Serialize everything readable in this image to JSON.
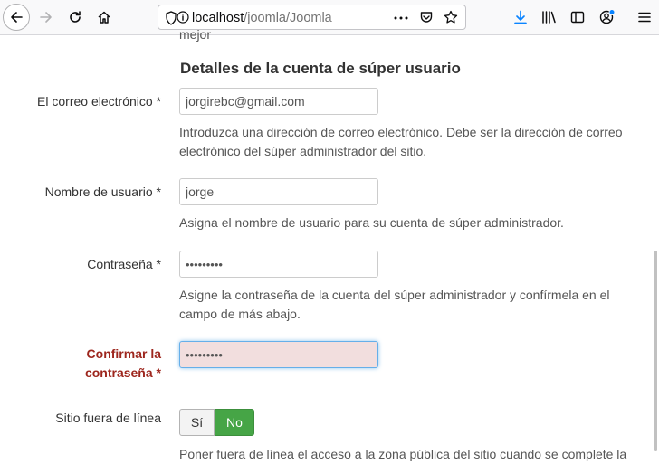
{
  "browser": {
    "url_host": "localhost",
    "url_path": "/joomla/Joomla"
  },
  "page": {
    "cut_off_text": "mejor",
    "section_title": "Detalles de la cuenta de súper usuario",
    "email": {
      "label": "El correo electrónico *",
      "value": "jorgirebc@gmail.com",
      "help": "Introduzca una dirección de correo electrónico. Debe ser la dirección de correo electrónico del súper administrador del sitio."
    },
    "username": {
      "label": "Nombre de usuario *",
      "value": "jorge",
      "help": "Asigna el nombre de usuario para su cuenta de súper administrador."
    },
    "password": {
      "label": "Contraseña *",
      "value": "•••••••••",
      "help": "Asigne la contraseña de la cuenta del súper administrador y confírmela en el campo de más abajo."
    },
    "confirm_password": {
      "label_line1": "Confirmar la",
      "label_line2": "contraseña *",
      "value": "•••••••••"
    },
    "offline": {
      "label": "Sitio fuera de línea",
      "yes": "Sí",
      "no": "No",
      "selected": "No",
      "help": "Poner fuera de línea el acceso a la zona pública del sitio cuando se complete la"
    }
  },
  "colors": {
    "error_label": "#9d261d",
    "error_input_bg": "#f2dede",
    "toggle_active": "#46a546",
    "download_icon": "#0a84ff"
  }
}
